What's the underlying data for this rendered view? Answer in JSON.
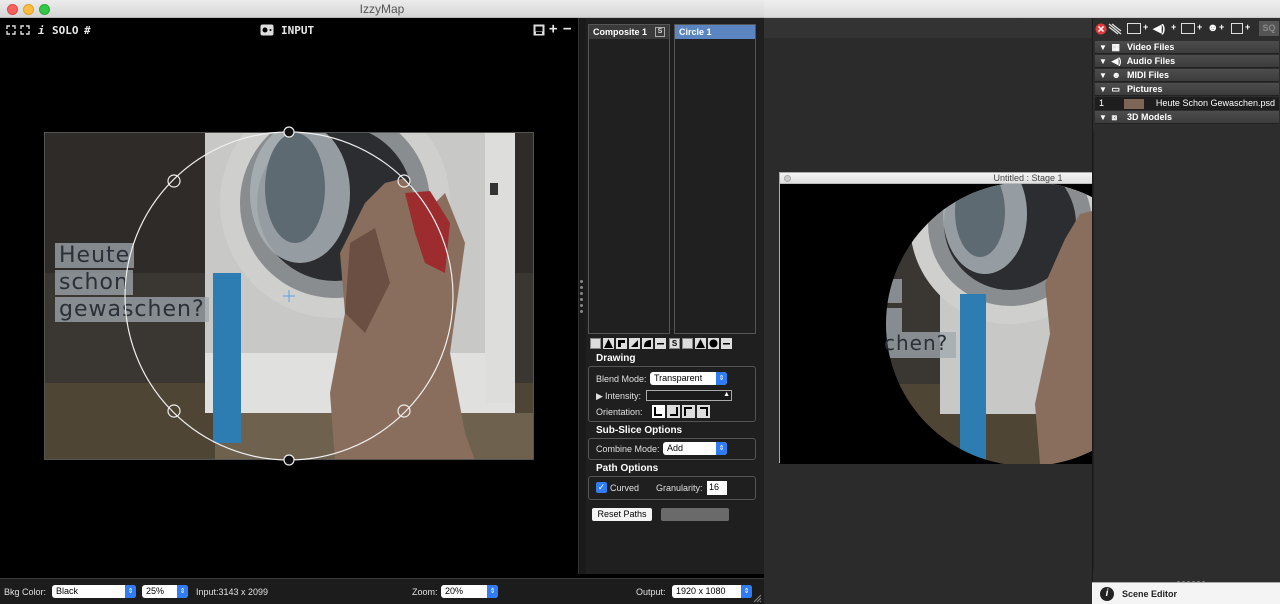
{
  "izzymap": {
    "title": "IzzyMap",
    "toolbar": {
      "info": "i",
      "solo": "SOLO",
      "hash": "#",
      "input_label": "INPUT",
      "plus": "+",
      "minus": "−"
    },
    "overlay_text": [
      "Heute",
      "schon",
      "gewaschen?"
    ],
    "layers": {
      "composite": "Composite 1",
      "composite_badge": "S",
      "circle": "Circle 1"
    },
    "drawing": {
      "section": "Drawing",
      "blend_mode_label": "Blend Mode:",
      "blend_mode_value": "Transparent",
      "intensity_label": "Intensity:",
      "orientation_label": "Orientation:"
    },
    "subslice": {
      "section": "Sub-Slice Options",
      "combine_mode_label": "Combine Mode:",
      "combine_mode_value": "Add"
    },
    "path": {
      "section": "Path Options",
      "curved_label": "Curved",
      "curved_checked": true,
      "granularity_label": "Granularity:",
      "granularity_value": "16",
      "reset_button": "Reset Paths"
    },
    "bottom": {
      "bkg_label": "Bkg Color:",
      "bkg_value": "Black",
      "scale_value": "25%",
      "input_info": "Input:3143 x 2099",
      "zoom_label": "Zoom:",
      "zoom_value": "20%",
      "output_label": "Output:",
      "output_value": "1920 x 1080"
    }
  },
  "stage": {
    "title": "Untitled : Stage 1",
    "overlay_text": [
      "chen?"
    ]
  },
  "media": {
    "sq_label": "SQ",
    "categories": [
      {
        "label": "Video Files",
        "icon": "film-icon"
      },
      {
        "label": "Audio Files",
        "icon": "speaker-icon"
      },
      {
        "label": "MIDI Files",
        "icon": "midi-icon"
      },
      {
        "label": "Pictures",
        "icon": "picture-icon"
      }
    ],
    "picture_item": {
      "index": "1",
      "name": "Heute Schon Gewaschen.psd"
    },
    "models": {
      "label": "3D Models",
      "icon": "cube-icon"
    },
    "scene_editor": "Scene Editor"
  },
  "colors": {
    "accent": "#2f7cf6",
    "layer_selected": "#5a85c0",
    "panel_bg": "#1f1f1f",
    "window_bg": "#000000"
  }
}
